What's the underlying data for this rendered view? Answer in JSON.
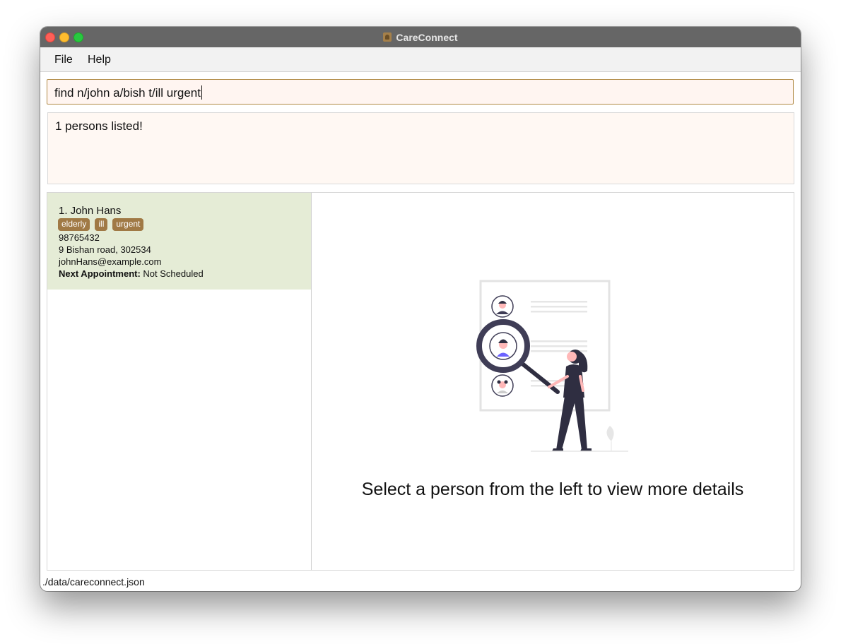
{
  "window": {
    "title": "CareConnect"
  },
  "menu": {
    "items": [
      "File",
      "Help"
    ]
  },
  "command": {
    "value": "find n/john a/bish t/ill urgent"
  },
  "result": {
    "message": "1 persons listed!"
  },
  "persons": [
    {
      "name": "1. John Hans",
      "tags": [
        "elderly",
        "ill",
        "urgent"
      ],
      "phone": "98765432",
      "address": "9 Bishan road, 302534",
      "email": "johnHans@example.com",
      "appointment_label": "Next Appointment:",
      "appointment_value": "Not Scheduled"
    }
  ],
  "detail": {
    "placeholder": "Select a person from the left to view more details"
  },
  "status": {
    "path": "./data/careconnect.json"
  },
  "colors": {
    "accent": "#a07945",
    "selected_card": "#e5ecd6",
    "command_bg": "#fff5f1",
    "result_bg": "#fff8f3",
    "titlebar": "#666666"
  },
  "icons": [
    "close-light",
    "minimize-light",
    "zoom-light",
    "app-icon",
    "search-people-illustration"
  ]
}
